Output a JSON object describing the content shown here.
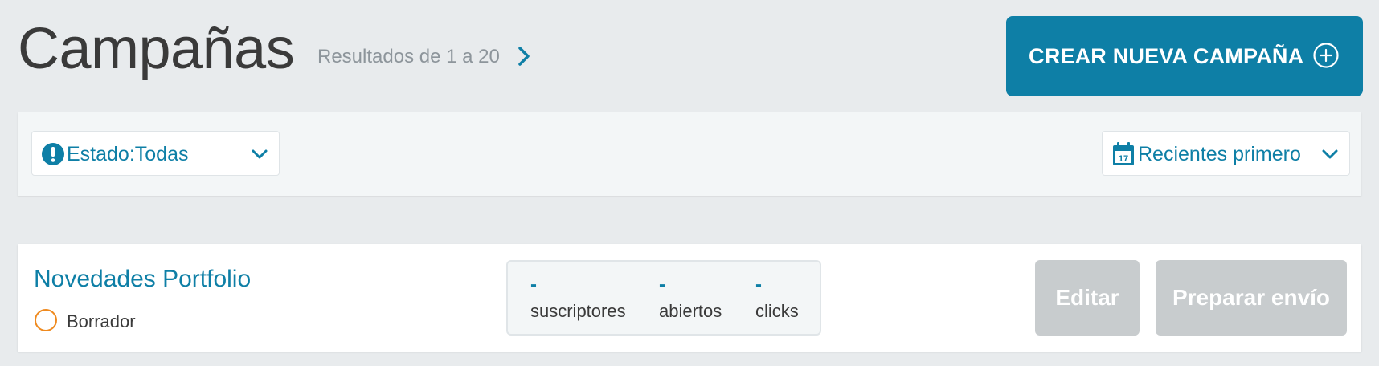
{
  "header": {
    "title": "Campañas",
    "results": "Resultados de 1 a 20",
    "create_button": "CREAR NUEVA CAMPAÑA"
  },
  "filters": {
    "estado": "Estado:Todas",
    "orden": "Recientes primero",
    "calendar_day": "17"
  },
  "campaigns": [
    {
      "name": "Novedades Portfolio",
      "status": "Borrador",
      "stats": [
        {
          "value": "-",
          "label": "suscriptores"
        },
        {
          "value": "-",
          "label": "abiertos"
        },
        {
          "value": "-",
          "label": "clicks"
        }
      ],
      "actions": {
        "edit": "Editar",
        "prepare": "Preparar envío"
      }
    }
  ],
  "colors": {
    "accent": "#0e7fa6",
    "draft_status": "#ef8a1f",
    "disabled_button": "#c8ccce",
    "background": "#e8ebed"
  },
  "icons": {
    "next": "chevron-right-icon",
    "create": "plus-circle-icon",
    "estado": "exclamation-circle-icon",
    "orden": "calendar-icon",
    "dropdown": "chevron-down-icon",
    "draft": "empty-circle-icon"
  }
}
